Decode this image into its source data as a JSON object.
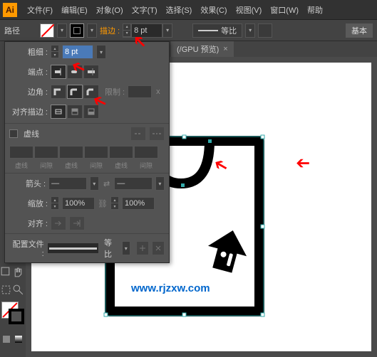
{
  "menubar": {
    "items": [
      "文件(F)",
      "编辑(E)",
      "对象(O)",
      "文字(T)",
      "选择(S)",
      "效果(C)",
      "视图(V)",
      "窗口(W)",
      "帮助"
    ]
  },
  "controlbar": {
    "path_label": "路径",
    "stroke_label": "描边 :",
    "stroke_value": "8 pt",
    "ratio_label": "等比",
    "basic_label": "基本"
  },
  "tab": {
    "title": "(/GPU 预览)"
  },
  "panel": {
    "weight_label": "粗细 :",
    "weight_value": "8 pt",
    "cap_label": "端点 :",
    "corner_label": "边角 :",
    "limit_label": "限制 :",
    "limit_value": "",
    "align_label": "对齐描边 :",
    "dashed_label": "虚线",
    "dash_labels": [
      "虚线",
      "间隙",
      "虚线",
      "间隙",
      "虚线",
      "间隙"
    ],
    "arrow_label": "箭头 :",
    "arrow_none": "—",
    "scale_label": "缩放 :",
    "scale_value": "100%",
    "align2_label": "对齐 :",
    "profile_label": "配置文件 :",
    "profile_value": "等比"
  },
  "watermark": "www.rjzxw.com"
}
